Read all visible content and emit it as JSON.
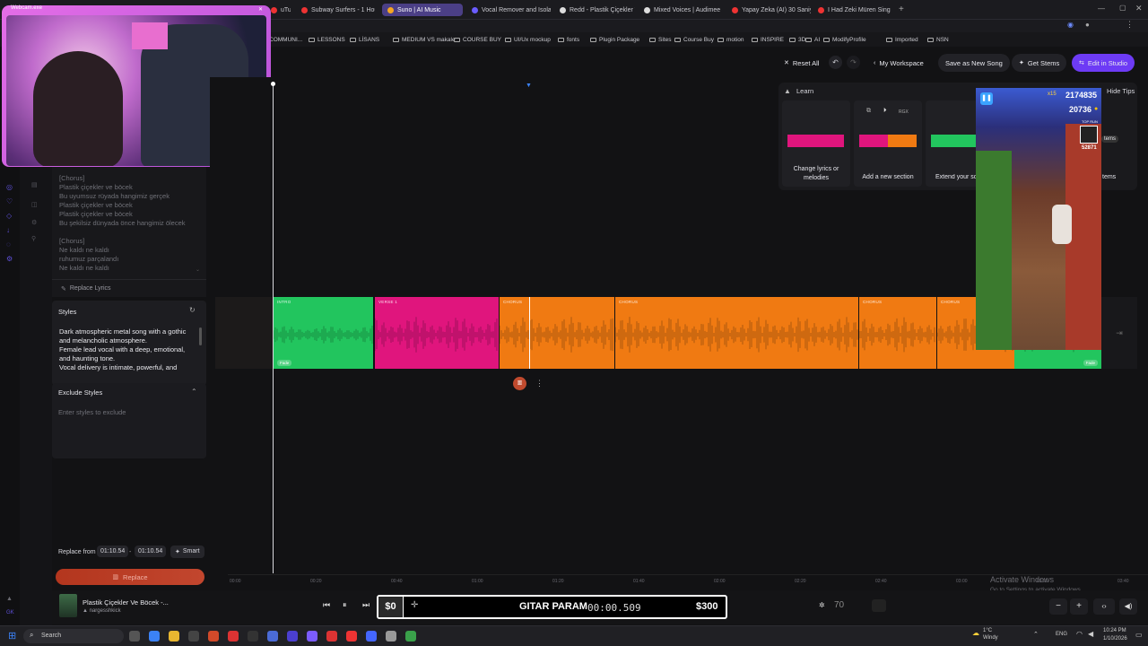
{
  "browser": {
    "tabs": [
      {
        "label": "uTube",
        "color": "#e33"
      },
      {
        "label": "Subway Surfers - 1 Hour G",
        "color": "#e33"
      },
      {
        "label": "Suno | AI Music",
        "color": "#f5a623",
        "active": true
      },
      {
        "label": "Vocal Remover and Isolat",
        "color": "#6a5cff"
      },
      {
        "label": "Redd - Plastik Çiçekler Ve",
        "color": "#ddd"
      },
      {
        "label": "Mixed Voices | Audimee",
        "color": "#ddd"
      },
      {
        "label": "Yapay Zeka (AI) 30 Saniye",
        "color": "#e33"
      },
      {
        "label": "I Had Zeki Müren Sing",
        "color": "#e33"
      }
    ],
    "bookmarks": [
      "COMMUNI...",
      "LESSONS",
      "LİSANS",
      "MEDIUM VS makale",
      "COURSE BUY",
      "UI/Ux mockup",
      "fonts",
      "Plugin Package",
      "Sites",
      "Course Buy",
      "motion",
      "INSPIRE",
      "3D",
      "AI",
      "ModifyProfile",
      "Imported",
      "NSN"
    ]
  },
  "webcam": {
    "title": "Webcam.exe"
  },
  "toolbar": {
    "reset_all": "Reset All",
    "my_workspace": "My Workspace",
    "save_as_new_song": "Save as New Song",
    "get_stems": "Get Stems",
    "edit_in_studio": "Edit in Studio"
  },
  "lyrics": {
    "lines": [
      "[Chorus]",
      "Plastik çiçekler ve böcek",
      "Bu uyumsuz rüyada hangimiz gerçek",
      "Plastik çiçekler ve böcek",
      "Plastik çiçekler ve böcek",
      "Bu şekilsiz dünyada önce hangimiz ölecek",
      "",
      "[Chorus]",
      "Ne kaldı ne kaldı",
      "ruhumuz parçalandı",
      "Ne kaldı ne kaldı"
    ],
    "replace_label": "Replace Lyrics"
  },
  "styles": {
    "title": "Styles",
    "text": [
      "Dark atmospheric metal song with a gothic",
      "and melancholic atmosphere.",
      "Female lead vocal with a deep, emotional,",
      "and haunting tone.",
      "Vocal delivery is intimate, powerful, and"
    ]
  },
  "exclude": {
    "title": "Exclude Styles",
    "placeholder": "Enter styles to exclude"
  },
  "replace": {
    "from_label": "Replace from",
    "start": "01:10.54",
    "end": "01:10.54",
    "mode": "Smart",
    "button": "Replace"
  },
  "tips": {
    "learn": "Learn",
    "hide": "Hide Tips",
    "cards": [
      {
        "label": "Change lyrics or melodies"
      },
      {
        "label": "Add a new section"
      },
      {
        "label": "Extend your so"
      },
      {
        "label": "tems"
      }
    ],
    "rgx": "RGX"
  },
  "timeline": {
    "clips": [
      {
        "label": "INTRO",
        "color": "#22c55e",
        "tag": "Fade"
      },
      {
        "label": "VERSE 1",
        "color": "#e0157d"
      },
      {
        "label": "CHORUS",
        "color": "#f07a12"
      },
      {
        "label": "CHORUS",
        "color": "#f07a12"
      },
      {
        "label": "CHORUS",
        "color": "#f07a12"
      },
      {
        "label": "CHORUS",
        "color": "#f07a12"
      },
      {
        "label": "",
        "color": "#22c55e",
        "tag": "Fade"
      }
    ],
    "ticks": [
      "00:00",
      "00:20",
      "00:40",
      "01:00",
      "01:20",
      "01:40",
      "02:00",
      "02:20",
      "02:40",
      "03:00",
      "03:20",
      "03:40"
    ]
  },
  "game": {
    "score": "2174835",
    "coins": "20736",
    "multiplier": "x15",
    "top_run": "TOP RUN",
    "top_value": "52871"
  },
  "player": {
    "song_title": "Plastik Çiçekler Ve Böcek -...",
    "artist": "nargesshkick",
    "overlay_left": "$0",
    "overlay_title": "GITAR PARAM",
    "overlay_time": "00:00.509",
    "overlay_right": "$300",
    "volume": "70"
  },
  "windows": {
    "activate_title": "Activate Windows",
    "activate_sub": "Go to Settings to activate Windows.",
    "search": "Search",
    "weather_temp": "1°C",
    "weather_desc": "Windy",
    "lang": "ENG",
    "time": "10:24 PM",
    "date": "1/10/2026"
  },
  "colors": {
    "accent": "#6d3bf5",
    "green": "#22c55e",
    "pink": "#e0157d",
    "orange": "#f07a12"
  }
}
